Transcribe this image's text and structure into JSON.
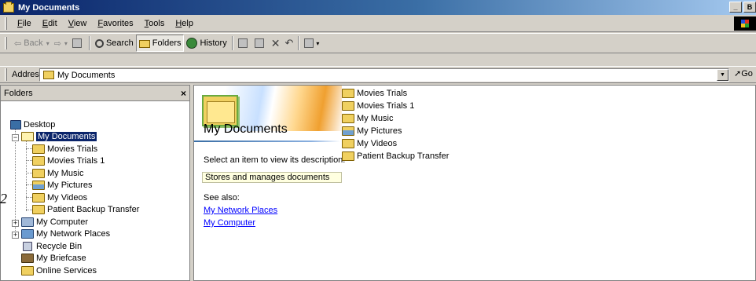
{
  "window": {
    "title": "My Documents",
    "controls": [
      "_",
      "B"
    ]
  },
  "menubar": {
    "items": [
      {
        "u": "F",
        "rest": "ile"
      },
      {
        "u": "E",
        "rest": "dit"
      },
      {
        "u": "V",
        "rest": "iew"
      },
      {
        "u": "F",
        "rest": "avorites"
      },
      {
        "u": "T",
        "rest": "ools"
      },
      {
        "u": "H",
        "rest": "elp"
      }
    ]
  },
  "toolbar": {
    "back": "Back",
    "search": "Search",
    "folders": "Folders",
    "history": "History"
  },
  "address": {
    "label": "Address",
    "value": "My Documents",
    "go": "Go"
  },
  "folders_pane": {
    "header": "Folders",
    "close": "×",
    "tree": [
      {
        "label": "Desktop"
      },
      {
        "label": "My Documents"
      },
      {
        "label": "Movies Trials"
      },
      {
        "label": "Movies Trials 1"
      },
      {
        "label": "My Music"
      },
      {
        "label": "My Pictures"
      },
      {
        "label": "My Videos"
      },
      {
        "label": "Patient Backup Transfer"
      },
      {
        "label": "My Computer"
      },
      {
        "label": "My Network Places"
      },
      {
        "label": "Recycle Bin"
      },
      {
        "label": "My Briefcase"
      },
      {
        "label": "Online Services"
      }
    ]
  },
  "content": {
    "title": "My Documents",
    "description": "Select an item to view its description.",
    "info": "Stores and manages documents",
    "see_also": "See also:",
    "links": [
      "My Network Places",
      "My Computer"
    ],
    "files": [
      "Movies Trials",
      "Movies Trials 1",
      "My Music",
      "My Pictures",
      "My Videos",
      "Patient Backup Transfer"
    ]
  },
  "margin_number": "2"
}
